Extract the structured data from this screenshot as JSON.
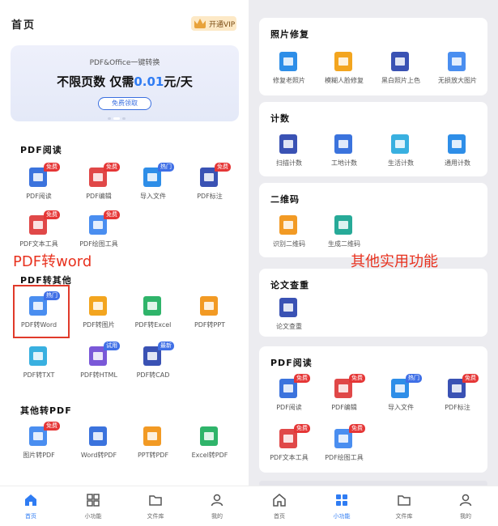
{
  "left": {
    "header": {
      "title": "首页",
      "vip_label": "开通VIP"
    },
    "banner": {
      "subtitle": "PDF&Office一键转换",
      "headline_pre": "不限页数 仅需",
      "headline_price": "0.01",
      "headline_post": "元/天",
      "cta": "免费领取"
    },
    "annotation": "PDF转word",
    "sections": [
      {
        "title": "PDF阅读",
        "items": [
          {
            "label": "PDF阅读",
            "badge": "免费"
          },
          {
            "label": "PDF编辑",
            "badge": "免费"
          },
          {
            "label": "导入文件",
            "badge": "热门"
          },
          {
            "label": "PDF标注",
            "badge": "免费"
          },
          {
            "label": "PDF文本工具",
            "badge": "免费"
          },
          {
            "label": "PDF绘图工具",
            "badge": "免费"
          }
        ]
      },
      {
        "title": "PDF转其他",
        "items": [
          {
            "label": "PDF转Word",
            "badge": "热门"
          },
          {
            "label": "PDF转图片",
            "badge": ""
          },
          {
            "label": "PDF转Excel",
            "badge": ""
          },
          {
            "label": "PDF转PPT",
            "badge": ""
          },
          {
            "label": "PDF转TXT",
            "badge": ""
          },
          {
            "label": "PDF转HTML",
            "badge": "试用"
          },
          {
            "label": "PDF转CAD",
            "badge": "最新"
          }
        ]
      },
      {
        "title": "其他转PDF",
        "items": [
          {
            "label": "图片转PDF",
            "badge": "免费"
          },
          {
            "label": "Word转PDF",
            "badge": ""
          },
          {
            "label": "PPT转PDF",
            "badge": ""
          },
          {
            "label": "Excel转PDF",
            "badge": ""
          }
        ]
      }
    ],
    "tabs": [
      {
        "label": "首页",
        "active": true
      },
      {
        "label": "小功能",
        "active": false
      },
      {
        "label": "文件库",
        "active": false
      },
      {
        "label": "我的",
        "active": false
      }
    ]
  },
  "right": {
    "annotation": "其他实用功能",
    "cards": [
      {
        "title": "照片修复",
        "items": [
          {
            "label": "修复老照片"
          },
          {
            "label": "模糊人脸修复"
          },
          {
            "label": "黑白照片上色"
          },
          {
            "label": "无损放大图片"
          }
        ]
      },
      {
        "title": "计数",
        "items": [
          {
            "label": "扫描计数"
          },
          {
            "label": "工地计数"
          },
          {
            "label": "生活计数"
          },
          {
            "label": "通用计数"
          }
        ]
      },
      {
        "title": "二维码",
        "items": [
          {
            "label": "识别二维码"
          },
          {
            "label": "生成二维码"
          }
        ]
      },
      {
        "title": "论文查重",
        "items": [
          {
            "label": "论文查重"
          }
        ]
      },
      {
        "title": "PDF阅读",
        "items": [
          {
            "label": "PDF阅读",
            "badge": "免费"
          },
          {
            "label": "PDF编辑",
            "badge": "免费"
          },
          {
            "label": "导入文件",
            "badge": "热门"
          },
          {
            "label": "PDF标注",
            "badge": "免费"
          },
          {
            "label": "PDF文本工具",
            "badge": "免费"
          },
          {
            "label": "PDF绘图工具",
            "badge": "免费"
          }
        ]
      }
    ],
    "tabs": [
      {
        "label": "首页",
        "active": false
      },
      {
        "label": "小功能",
        "active": true
      },
      {
        "label": "文件库",
        "active": false
      },
      {
        "label": "我的",
        "active": false
      }
    ]
  },
  "colors": {
    "accent": "#2f7cf3",
    "annotation": "#e8321f",
    "badge_red": "#e53636",
    "badge_blue": "#3f6fe6"
  }
}
